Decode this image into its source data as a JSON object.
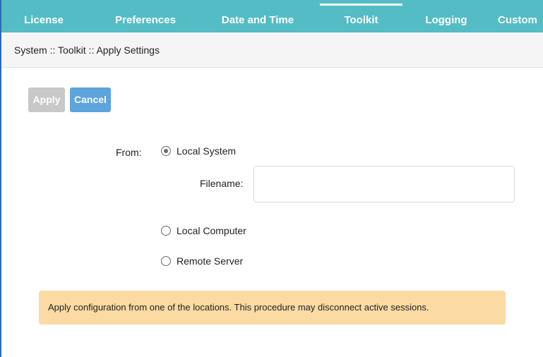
{
  "tabs": [
    {
      "label": "License"
    },
    {
      "label": "Preferences"
    },
    {
      "label": "Date and Time"
    },
    {
      "label": "Toolkit",
      "active": true
    },
    {
      "label": "Logging"
    },
    {
      "label": "Custom"
    }
  ],
  "breadcrumb": "System :: Toolkit :: Apply Settings",
  "buttons": {
    "apply": "Apply",
    "cancel": "Cancel"
  },
  "form": {
    "from_label": "From:",
    "options": [
      {
        "label": "Local System",
        "selected": true
      },
      {
        "label": "Local Computer",
        "selected": false
      },
      {
        "label": "Remote Server",
        "selected": false
      }
    ],
    "filename_label": "Filename:",
    "filename_value": ""
  },
  "alert": "Apply configuration from one of the locations. This procedure may disconnect active sessions.",
  "colors": {
    "tabbar": "#54bcc4",
    "apply_disabled": "#c8c8c8",
    "cancel": "#5da4dc",
    "alert_bg": "#fbdba3"
  }
}
